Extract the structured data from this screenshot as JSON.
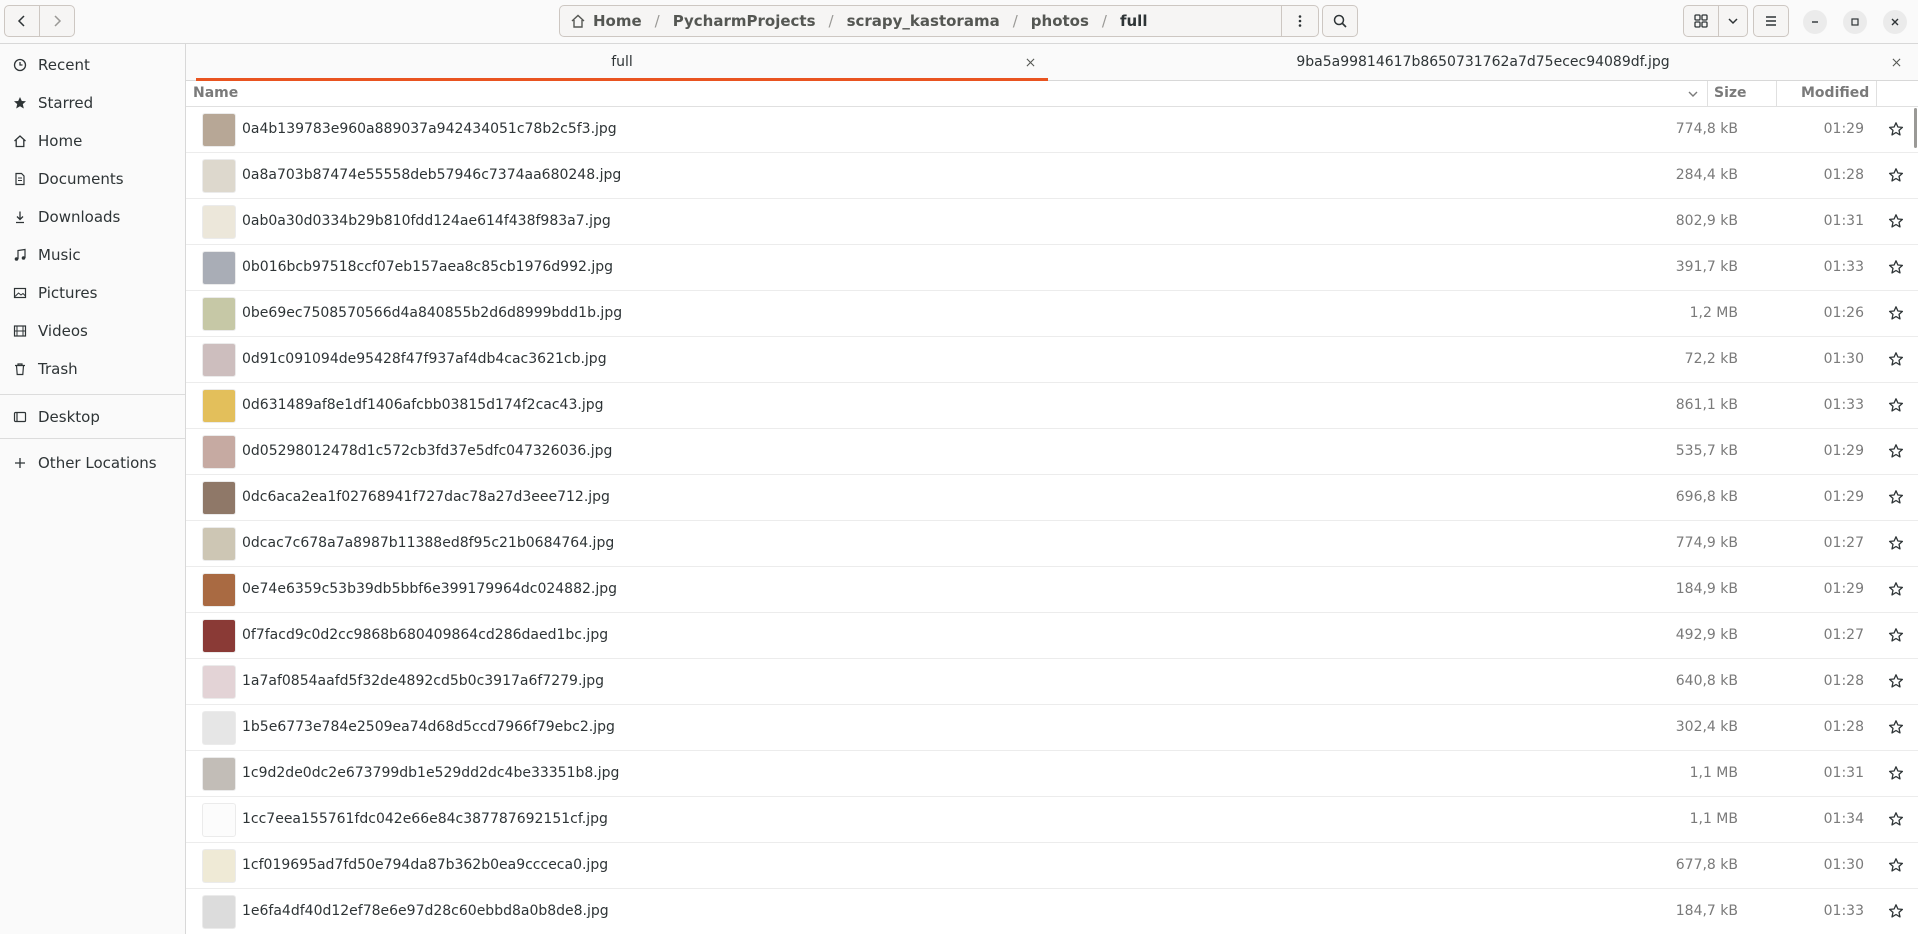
{
  "header": {
    "path": [
      "Home",
      "PycharmProjects",
      "scrapy_kastorama",
      "photos",
      "full"
    ]
  },
  "sidebar": {
    "items": [
      {
        "label": "Recent",
        "icon": "clock-icon"
      },
      {
        "label": "Starred",
        "icon": "star-icon"
      },
      {
        "label": "Home",
        "icon": "home-icon"
      },
      {
        "label": "Documents",
        "icon": "document-icon"
      },
      {
        "label": "Downloads",
        "icon": "download-icon"
      },
      {
        "label": "Music",
        "icon": "music-icon"
      },
      {
        "label": "Pictures",
        "icon": "pictures-icon"
      },
      {
        "label": "Videos",
        "icon": "video-icon"
      },
      {
        "label": "Trash",
        "icon": "trash-icon"
      }
    ],
    "devices": [
      {
        "label": "Desktop",
        "icon": "desktop-icon"
      }
    ],
    "other": {
      "label": "Other Locations",
      "icon": "plus-icon"
    }
  },
  "tabs": [
    {
      "label": "full",
      "active": true
    },
    {
      "label": "9ba5a99814617b8650731762a7d75ecec94089df.jpg",
      "active": false
    }
  ],
  "columns": {
    "name": "Name",
    "size": "Size",
    "modified": "Modified"
  },
  "files": [
    {
      "name": "0a4b139783e960a889037a942434051c78b2c5f3.jpg",
      "size": "774,8 kB",
      "modified": "01:29",
      "thumb": "#b7a796"
    },
    {
      "name": "0a8a703b87474e55558deb57946c7374aa680248.jpg",
      "size": "284,4 kB",
      "modified": "01:28",
      "thumb": "#ddd8cd"
    },
    {
      "name": "0ab0a30d0334b29b810fdd124ae614f438f983a7.jpg",
      "size": "802,9 kB",
      "modified": "01:31",
      "thumb": "#ece7da"
    },
    {
      "name": "0b016bcb97518ccf07eb157aea8c85cb1976d992.jpg",
      "size": "391,7 kB",
      "modified": "01:33",
      "thumb": "#a9adb6"
    },
    {
      "name": "0be69ec7508570566d4a840855b2d6d8999bdd1b.jpg",
      "size": "1,2 MB",
      "modified": "01:26",
      "thumb": "#c6c8a6"
    },
    {
      "name": "0d91c091094de95428f47f937af4db4cac3621cb.jpg",
      "size": "72,2 kB",
      "modified": "01:30",
      "thumb": "#cdbebe"
    },
    {
      "name": "0d631489af8e1df1406afcbb03815d174f2cac43.jpg",
      "size": "861,1 kB",
      "modified": "01:33",
      "thumb": "#e3bf5b"
    },
    {
      "name": "0d05298012478d1c572cb3fd37e5dfc047326036.jpg",
      "size": "535,7 kB",
      "modified": "01:29",
      "thumb": "#c6aaa2"
    },
    {
      "name": "0dc6aca2ea1f02768941f727dac78a27d3eee712.jpg",
      "size": "696,8 kB",
      "modified": "01:29",
      "thumb": "#8f7868"
    },
    {
      "name": "0dcac7c678a7a8987b11388ed8f95c21b0684764.jpg",
      "size": "774,9 kB",
      "modified": "01:27",
      "thumb": "#cdc6b4"
    },
    {
      "name": "0e74e6359c53b39db5bbf6e399179964dc024882.jpg",
      "size": "184,9 kB",
      "modified": "01:29",
      "thumb": "#a96a42"
    },
    {
      "name": "0f7facd9c0d2cc9868b680409864cd286daed1bc.jpg",
      "size": "492,9 kB",
      "modified": "01:27",
      "thumb": "#8a3a36"
    },
    {
      "name": "1a7af0854aafd5f32de4892cd5b0c3917a6f7279.jpg",
      "size": "640,8 kB",
      "modified": "01:28",
      "thumb": "#e3d3d6"
    },
    {
      "name": "1b5e6773e784e2509ea74d68d5ccd7966f79ebc2.jpg",
      "size": "302,4 kB",
      "modified": "01:28",
      "thumb": "#e6e6e6"
    },
    {
      "name": "1c9d2de0dc2e673799db1e529dd2dc4be33351b8.jpg",
      "size": "1,1 MB",
      "modified": "01:31",
      "thumb": "#c2bdb7"
    },
    {
      "name": "1cc7eea155761fdc042e66e84c387787692151cf.jpg",
      "size": "1,1 MB",
      "modified": "01:34",
      "thumb": "#fcfcfc"
    },
    {
      "name": "1cf019695ad7fd50e794da87b362b0ea9ccceca0.jpg",
      "size": "677,8 kB",
      "modified": "01:30",
      "thumb": "#efead6"
    },
    {
      "name": "1e6fa4df40d12ef78e6e97d28c60ebbd8a0b8de8.jpg",
      "size": "184,7 kB",
      "modified": "01:33",
      "thumb": "#dcdcdc"
    }
  ]
}
